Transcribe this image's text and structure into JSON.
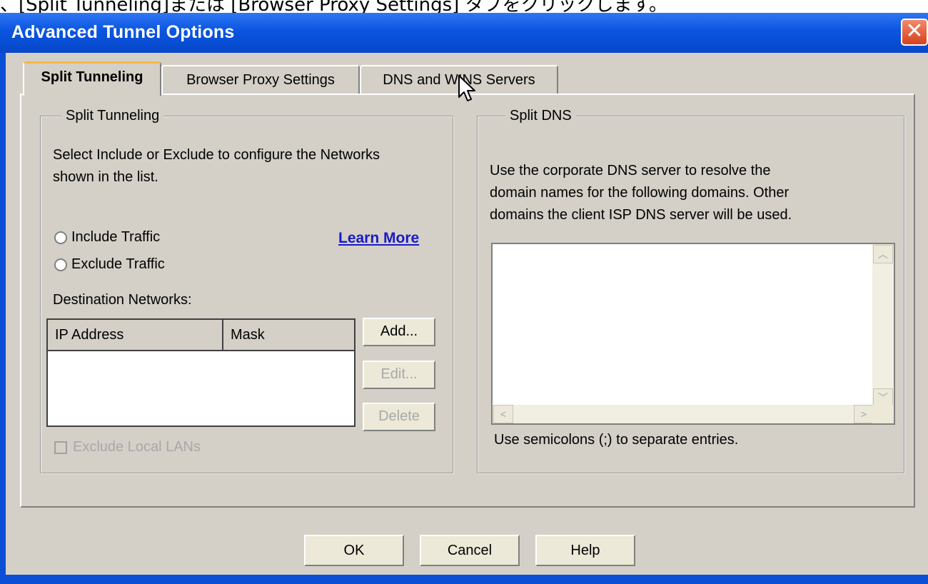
{
  "caption": "、[Split Tunneling]または [Browser Proxy Settings] タブをクリックします。",
  "window": {
    "title": "Advanced Tunnel Options",
    "close_glyph": "✕"
  },
  "tabs": [
    {
      "label": "Split Tunneling",
      "active": true
    },
    {
      "label": "Browser Proxy Settings",
      "active": false
    },
    {
      "label": "DNS and WINS Servers",
      "active": false
    }
  ],
  "split_tunneling": {
    "group_title": "Split Tunneling",
    "description_line1": "Select Include or Exclude to configure the Networks",
    "description_line2": "shown in the list.",
    "include_label": "Include Traffic",
    "exclude_label": "Exclude Traffic",
    "learn_more": "Learn More",
    "destination_label": "Destination Networks:",
    "columns": [
      "IP Address",
      "Mask"
    ],
    "rows": [],
    "add_button": "Add...",
    "edit_button": "Edit...",
    "delete_button": "Delete",
    "exclude_local_lans": "Exclude Local LANs"
  },
  "split_dns": {
    "group_title": "Split DNS",
    "description_line1": "Use the corporate DNS server to resolve the",
    "description_line2": "domain names for the following domains. Other",
    "description_line3": "domains the client ISP DNS server will be used.",
    "domains_value": "",
    "hint": "Use semicolons (;) to separate entries."
  },
  "footer": {
    "ok": "OK",
    "cancel": "Cancel",
    "help": "Help"
  },
  "colors": {
    "titlebar": "#0a55e0",
    "dialog": "#d4d0c8",
    "link": "#1a1ac8"
  }
}
